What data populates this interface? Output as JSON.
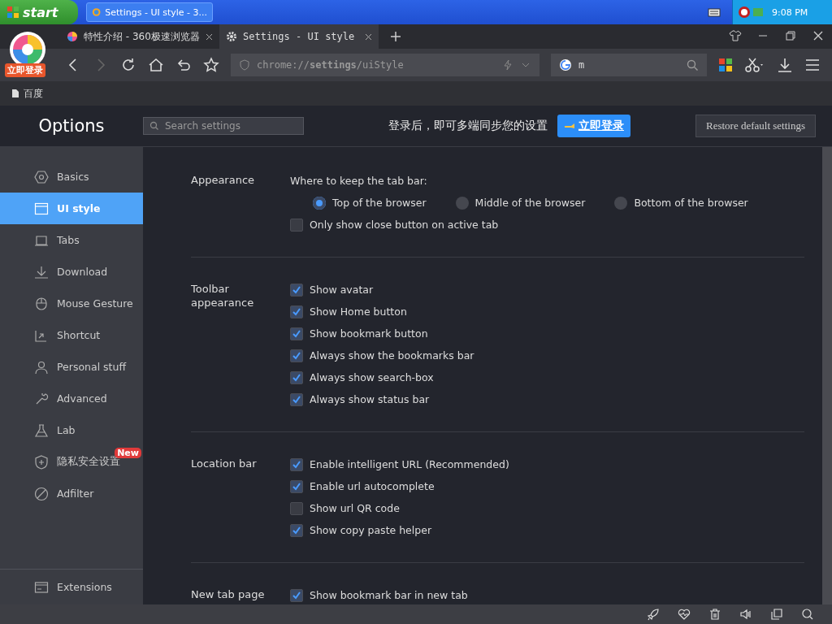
{
  "taskbar": {
    "start_label": "start",
    "task_title": "Settings - UI style - 3...",
    "clock": "9:08 PM"
  },
  "browser": {
    "avatar_badge": "立即登录",
    "tabs": [
      {
        "title": "特性介绍 - 360极速浏览器",
        "selected": false
      },
      {
        "title": "Settings - UI style",
        "selected": true
      }
    ],
    "address": "chrome://**settings**/uiStyle",
    "search_value": "m",
    "bookmarks": [
      {
        "label": "百度"
      }
    ]
  },
  "options": {
    "title": "Options",
    "search_placeholder": "Search settings",
    "login_prompt": "登录后，即可多端同步您的设置",
    "login_button": "立即登录",
    "restore_button": "Restore default settings"
  },
  "sidebar": {
    "items": [
      {
        "label": "Basics",
        "selected": false
      },
      {
        "label": "UI style",
        "selected": true
      },
      {
        "label": "Tabs",
        "selected": false
      },
      {
        "label": "Download",
        "selected": false
      },
      {
        "label": "Mouse Gesture",
        "selected": false
      },
      {
        "label": "Shortcut",
        "selected": false
      },
      {
        "label": "Personal stuff",
        "selected": false
      },
      {
        "label": "Advanced",
        "selected": false
      },
      {
        "label": "Lab",
        "selected": false
      },
      {
        "label": "隐私安全设置",
        "selected": false,
        "badge": "New"
      },
      {
        "label": "Adfilter",
        "selected": false
      }
    ],
    "footer": {
      "label": "Extensions"
    }
  },
  "sections": [
    {
      "title": "Appearance",
      "rows": [
        {
          "kind": "caption",
          "text": "Where to keep the tab bar:"
        },
        {
          "kind": "radios",
          "options": [
            {
              "label": "Top of the browser",
              "selected": true
            },
            {
              "label": "Middle of the browser",
              "selected": false
            },
            {
              "label": "Bottom of the browser",
              "selected": false
            }
          ]
        },
        {
          "kind": "checkbox",
          "label": "Only show close button on active tab",
          "checked": false
        }
      ]
    },
    {
      "title": "Toolbar appearance",
      "rows": [
        {
          "kind": "checkbox",
          "label": "Show avatar",
          "checked": true
        },
        {
          "kind": "checkbox",
          "label": "Show Home button",
          "checked": true
        },
        {
          "kind": "checkbox",
          "label": "Show bookmark button",
          "checked": true
        },
        {
          "kind": "checkbox",
          "label": "Always show the bookmarks bar",
          "checked": true
        },
        {
          "kind": "checkbox",
          "label": "Always show search-box",
          "checked": true
        },
        {
          "kind": "checkbox",
          "label": "Always show status bar",
          "checked": true
        }
      ]
    },
    {
      "title": "Location bar",
      "rows": [
        {
          "kind": "checkbox",
          "label": "Enable intelligent URL (Recommended)",
          "checked": true
        },
        {
          "kind": "checkbox",
          "label": "Enable url autocomplete",
          "checked": true
        },
        {
          "kind": "checkbox",
          "label": "Show url QR code",
          "checked": false
        },
        {
          "kind": "checkbox",
          "label": "Show copy paste helper",
          "checked": true
        }
      ]
    },
    {
      "title": "New tab page",
      "rows": [
        {
          "kind": "checkbox",
          "label": "Show bookmark bar in new tab",
          "checked": true
        }
      ]
    }
  ]
}
